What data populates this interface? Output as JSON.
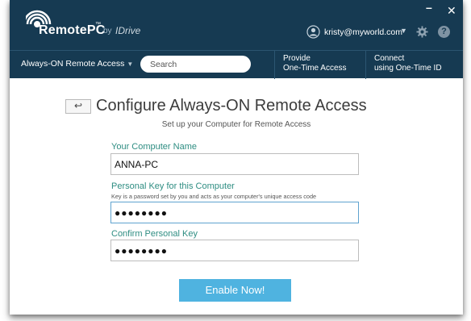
{
  "app": {
    "brand": "RemotePC",
    "brand_tm": "™",
    "by": "by",
    "partner": "IDrive"
  },
  "window_controls": {
    "minimize": "–",
    "close": "✕"
  },
  "user": {
    "email": "kristy@myworld.com",
    "caret": "▼"
  },
  "icons": {
    "user": "user-icon",
    "settings": "gear-icon",
    "help": "help-icon",
    "logo": "remotepc-logo-icon"
  },
  "nav": {
    "dropdown_label": "Always-ON Remote Access",
    "dropdown_caret": "▼",
    "search_placeholder": "Search",
    "link1_line1": "Provide",
    "link1_line2": "One-Time Access",
    "link2_line1": "Connect",
    "link2_line2": "using One-Time ID"
  },
  "main": {
    "back_icon": "↩",
    "title": "Configure Always-ON Remote Access",
    "subtitle": "Set up your Computer for Remote Access",
    "computer_name_label": "Your Computer Name",
    "computer_name_value": "ANNA-PC",
    "personal_key_label": "Personal Key for this Computer",
    "personal_key_hint": "Key is a password set by you and acts as your computer's unique access code",
    "personal_key_masked": "●●●●●●●●",
    "confirm_key_label": "Confirm Personal Key",
    "confirm_key_masked": "●●●●●●●●",
    "enable_button": "Enable Now!"
  },
  "colors": {
    "header_bg": "#163a52",
    "label_teal": "#2e8d82",
    "button_blue": "#4fb3e0"
  }
}
